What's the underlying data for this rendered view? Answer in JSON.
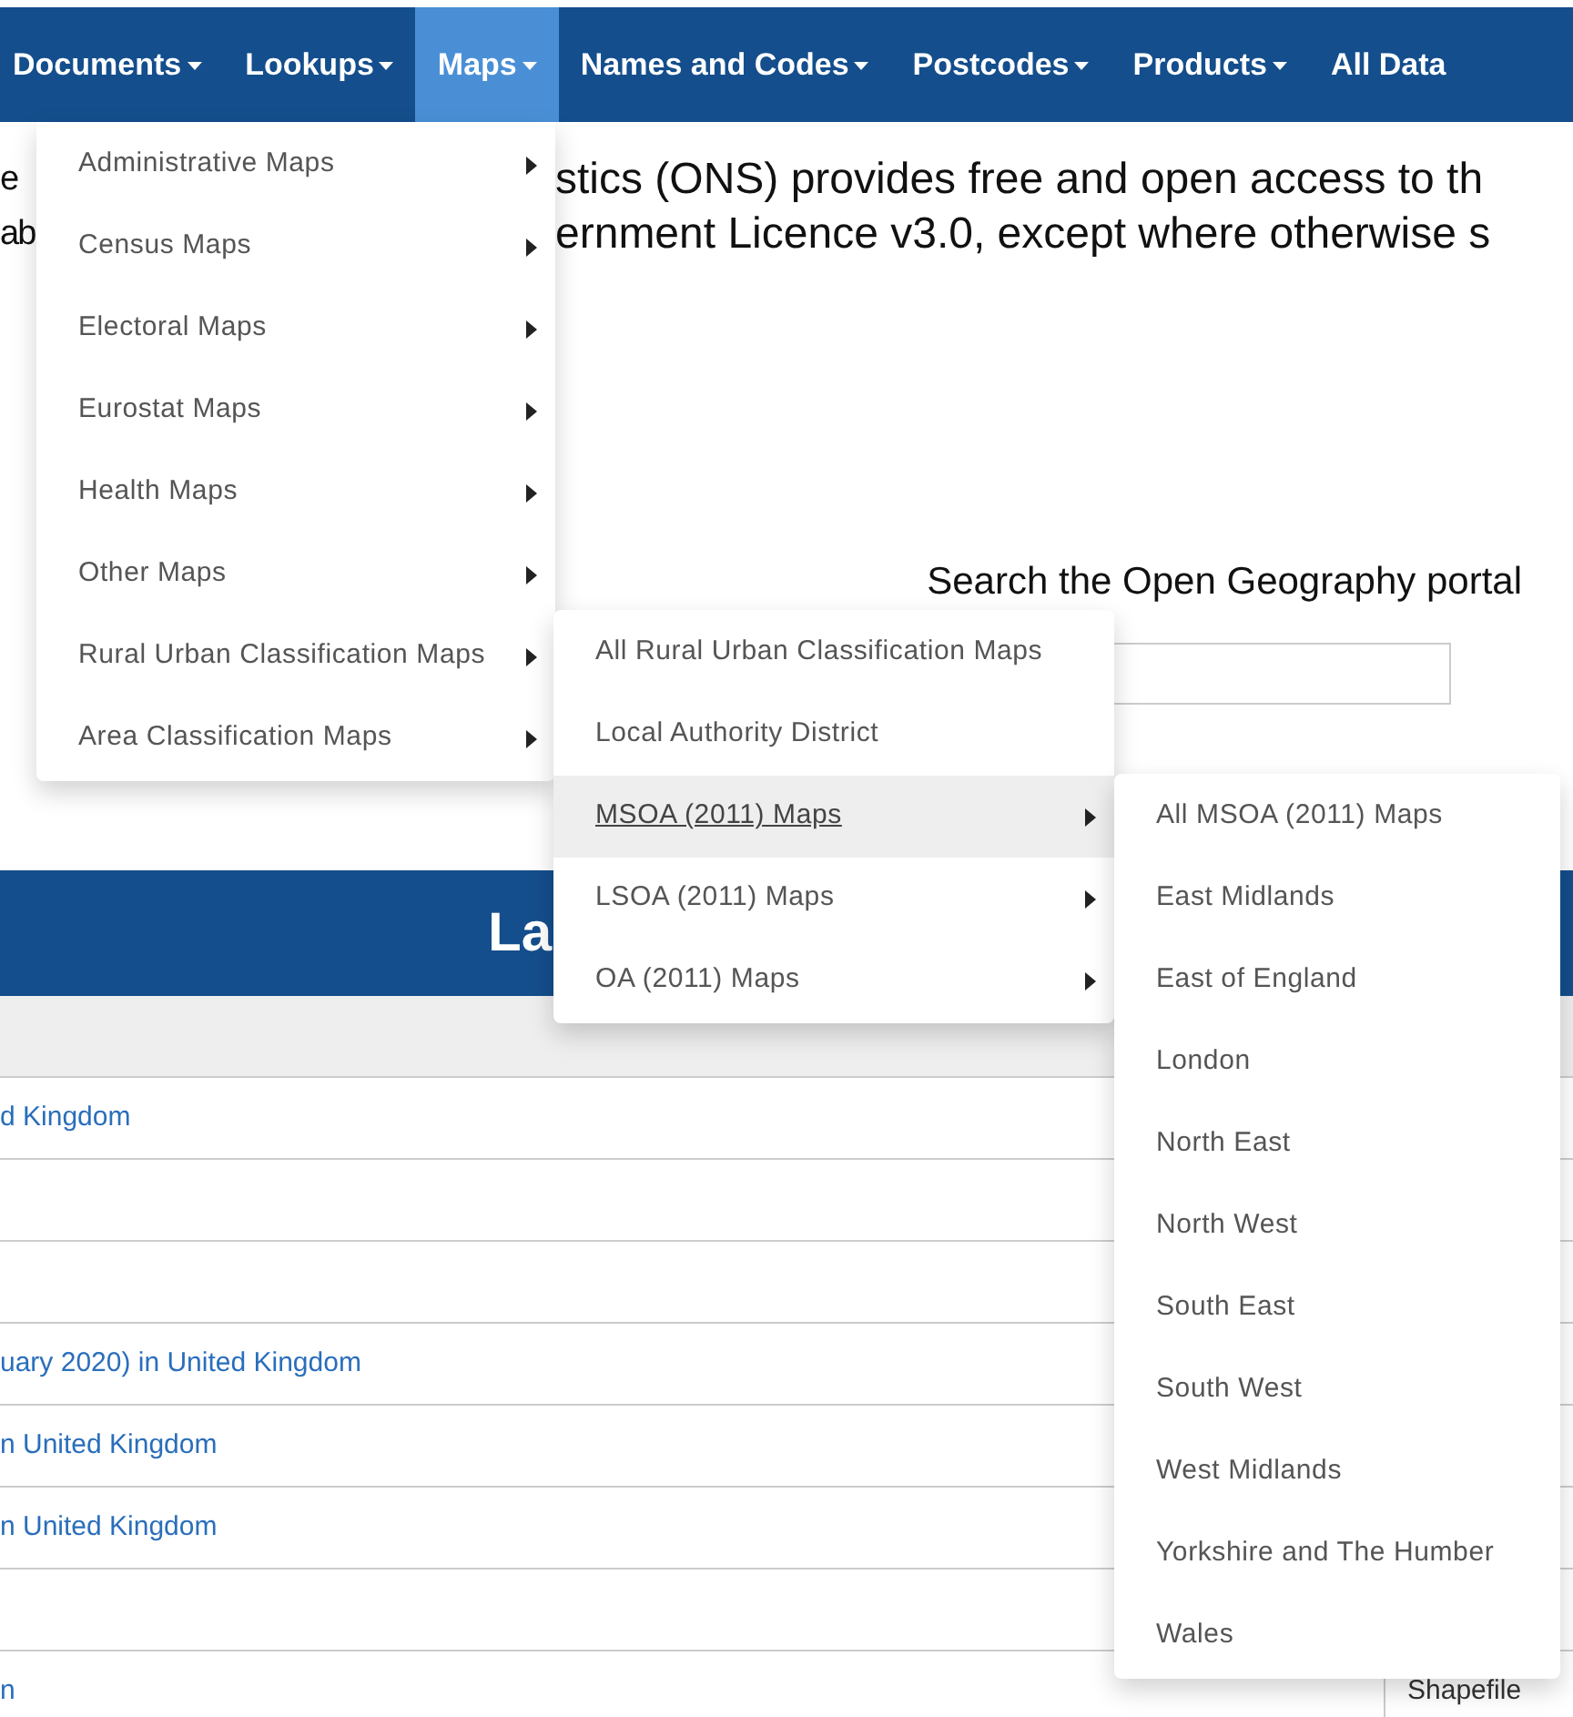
{
  "nav": {
    "items": [
      {
        "label": "Documents",
        "has_caret": true,
        "selected": false
      },
      {
        "label": "Lookups",
        "has_caret": true,
        "selected": false
      },
      {
        "label": "Maps",
        "has_caret": true,
        "selected": true
      },
      {
        "label": "Names and Codes",
        "has_caret": true,
        "selected": false
      },
      {
        "label": "Postcodes",
        "has_caret": true,
        "selected": false
      },
      {
        "label": "Products",
        "has_caret": true,
        "selected": false
      },
      {
        "label": "All Data",
        "has_caret": false,
        "selected": false
      }
    ]
  },
  "intro_lines": [
    {
      "fragments": [
        "e",
        "stics (ONS) provides free and open access to th"
      ]
    },
    {
      "fragments": [
        "ab",
        "ernment Licence v3.0, except where otherwise s"
      ]
    }
  ],
  "search": {
    "heading": "Search the Open Geography portal"
  },
  "banner": {
    "title_fragment": "La"
  },
  "table": {
    "rows": [
      {
        "link": "d Kingdom"
      },
      {},
      {},
      {
        "link": "uary 2020) in United Kingdom"
      },
      {
        "link": "n United Kingdom"
      },
      {
        "link": "n United Kingdom"
      },
      {},
      {
        "link": "n",
        "column_2": "Shapefile"
      }
    ]
  },
  "maps_menu": {
    "items": [
      {
        "label": "Administrative Maps",
        "has_submenu": true,
        "selected": false
      },
      {
        "label": "Census Maps",
        "has_submenu": true,
        "selected": false
      },
      {
        "label": "Electoral Maps",
        "has_submenu": true,
        "selected": false
      },
      {
        "label": "Eurostat Maps",
        "has_submenu": true,
        "selected": false
      },
      {
        "label": "Health Maps",
        "has_submenu": true,
        "selected": false
      },
      {
        "label": "Other Maps",
        "has_submenu": true,
        "selected": false
      },
      {
        "label": "Rural Urban Classification Maps",
        "has_submenu": true,
        "selected": false
      },
      {
        "label": "Area Classification Maps",
        "has_submenu": true,
        "selected": false
      }
    ]
  },
  "rural_urban_menu": {
    "items": [
      {
        "label": "All Rural Urban Classification Maps",
        "has_submenu": false,
        "selected": false
      },
      {
        "label": "Local Authority District",
        "has_submenu": false,
        "selected": false
      },
      {
        "label": "MSOA (2011) Maps",
        "has_submenu": true,
        "selected": true
      },
      {
        "label": "LSOA (2011) Maps",
        "has_submenu": true,
        "selected": false
      },
      {
        "label": "OA (2011) Maps",
        "has_submenu": true,
        "selected": false
      }
    ]
  },
  "msoa_menu": {
    "items": [
      {
        "label": "All MSOA (2011) Maps",
        "has_submenu": false,
        "selected": false
      },
      {
        "label": "East Midlands",
        "has_submenu": false,
        "selected": false
      },
      {
        "label": "East of England",
        "has_submenu": false,
        "selected": false
      },
      {
        "label": "London",
        "has_submenu": false,
        "selected": false
      },
      {
        "label": "North East",
        "has_submenu": false,
        "selected": false
      },
      {
        "label": "North West",
        "has_submenu": false,
        "selected": false
      },
      {
        "label": "South East",
        "has_submenu": false,
        "selected": false
      },
      {
        "label": "South West",
        "has_submenu": false,
        "selected": false
      },
      {
        "label": "West Midlands",
        "has_submenu": false,
        "selected": false
      },
      {
        "label": "Yorkshire and The Humber",
        "has_submenu": false,
        "selected": false
      },
      {
        "label": "Wales",
        "has_submenu": false,
        "selected": false
      }
    ]
  }
}
